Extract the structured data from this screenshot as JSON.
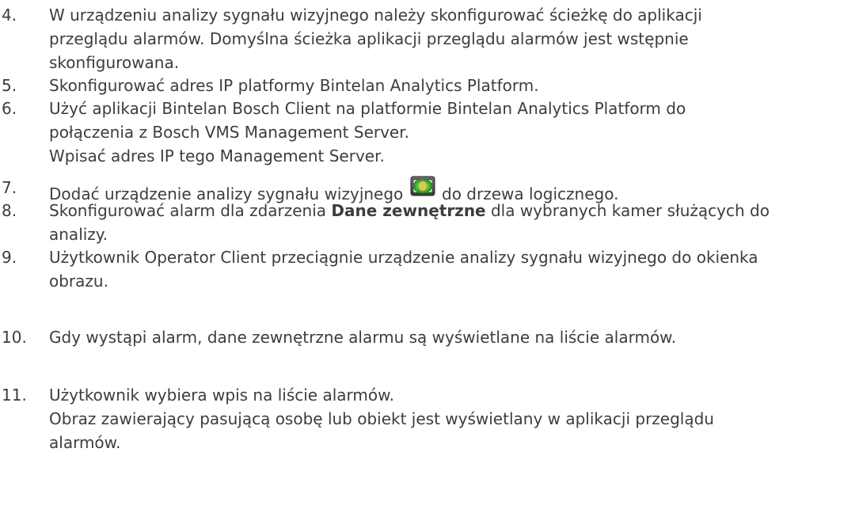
{
  "steps": [
    {
      "num": "4.",
      "lines": [
        "W urządzeniu analizy sygnału wizyjnego należy skonfigurować ścieżkę do aplikacji",
        "przeglądu alarmów. Domyślna ścieżka aplikacji przeglądu alarmów jest wstępnie",
        "skonfigurowana."
      ]
    },
    {
      "num": "5.",
      "lines": [
        "Skonfigurować adres IP platformy Bintelan Analytics Platform."
      ]
    },
    {
      "num": "6.",
      "lines": [
        "Użyć aplikacji Bintelan Bosch Client na platformie Bintelan Analytics Platform do",
        "połączenia z Bosch VMS Management Server.",
        "Wpisać adres IP tego Management Server."
      ]
    },
    {
      "num": "7.",
      "before": "Dodać urządzenie analizy sygnału wizyjnego",
      "after": "do drzewa logicznego.",
      "icon": "video-analytics-device-icon"
    },
    {
      "num": "8.",
      "before": "Skonfigurować alarm dla zdarzenia",
      "bold": "Dane zewnętrzne",
      "after": "dla wybranych kamer służących do",
      "line2": "analizy."
    },
    {
      "num": "9.",
      "lines": [
        "Użytkownik Operator Client przeciągnie urządzenie analizy sygnału wizyjnego do okienka",
        "obrazu."
      ]
    },
    {
      "num": "10.",
      "lines": [
        "Gdy wystąpi alarm, dane zewnętrzne alarmu są wyświetlane na liście alarmów."
      ]
    },
    {
      "num": "11.",
      "lines": [
        "Użytkownik wybiera wpis na liście alarmów.",
        "Obraz zawierający pasującą osobę lub obiekt jest wyświetlany w aplikacji przeglądu",
        "alarmów."
      ]
    }
  ]
}
